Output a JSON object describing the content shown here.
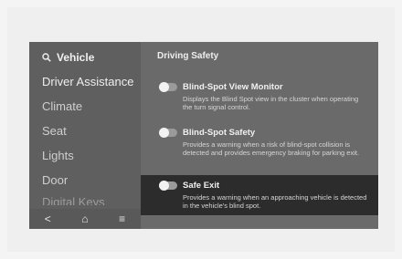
{
  "sidebar": {
    "title": "Vehicle",
    "items": [
      {
        "label": "Driver Assistance"
      },
      {
        "label": "Climate"
      },
      {
        "label": "Seat"
      },
      {
        "label": "Lights"
      },
      {
        "label": "Door"
      },
      {
        "label": "Digital Keys"
      }
    ],
    "nav": {
      "back": "<",
      "home": "⌂",
      "menu": "≡"
    }
  },
  "content": {
    "title": "Driving Safety",
    "options": [
      {
        "title": "Blind-Spot View Monitor",
        "description": "Displays the Blind Spot view in the cluster when operating the turn signal control.",
        "enabled": false
      },
      {
        "title": "Blind-Spot Safety",
        "description": "Provides a warning when a risk of blind-spot collision is detected and provides emergency braking for parking exit.",
        "enabled": false
      },
      {
        "title": "Safe Exit",
        "description": "Provides a warning when an approaching vehicle is detected in the vehicle's blind spot.",
        "enabled": false
      }
    ]
  },
  "colors": {
    "screen_bg": "#6a6a6a",
    "sidebar_bg": "#5f5f5f",
    "selected_option_bg": "#2c2c2c"
  }
}
